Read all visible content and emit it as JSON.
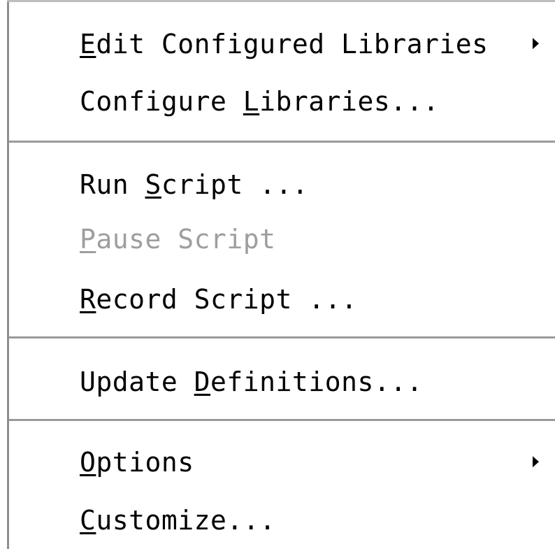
{
  "menu": {
    "items": [
      {
        "before": "",
        "key": "E",
        "after": "dit Configured Libraries",
        "submenu": true,
        "disabled": false,
        "name": "menu-item-edit-configured-libraries"
      },
      {
        "before": "Configure ",
        "key": "L",
        "after": "ibraries...",
        "submenu": false,
        "disabled": false,
        "name": "menu-item-configure-libraries"
      },
      {
        "before": "Run ",
        "key": "S",
        "after": "cript ...",
        "submenu": false,
        "disabled": false,
        "name": "menu-item-run-script"
      },
      {
        "before": "",
        "key": "P",
        "after": "ause Script",
        "submenu": false,
        "disabled": true,
        "name": "menu-item-pause-script"
      },
      {
        "before": "",
        "key": "R",
        "after": "ecord Script ...",
        "submenu": false,
        "disabled": false,
        "name": "menu-item-record-script"
      },
      {
        "before": "Update ",
        "key": "D",
        "after": "efinitions...",
        "submenu": false,
        "disabled": false,
        "name": "menu-item-update-definitions"
      },
      {
        "before": "",
        "key": "O",
        "after": "ptions",
        "submenu": true,
        "disabled": false,
        "name": "menu-item-options"
      },
      {
        "before": "",
        "key": "C",
        "after": "ustomize...",
        "submenu": false,
        "disabled": false,
        "name": "menu-item-customize"
      }
    ]
  },
  "colors": {
    "text": "#000000",
    "disabled_text": "#9e9e9e",
    "separator": "#9a9a9a",
    "background": "#ffffff"
  }
}
